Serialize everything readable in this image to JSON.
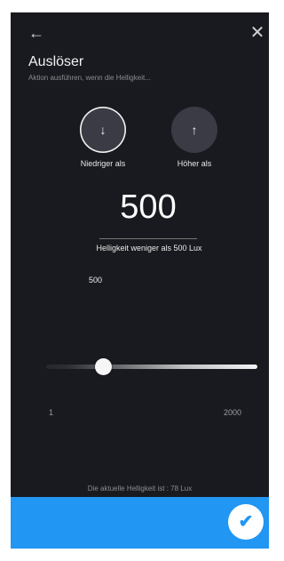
{
  "header": {
    "back_icon": "←",
    "close_icon": "✕",
    "title": "Auslöser",
    "subtitle": "Aktion ausführen, wenn die Helligkeit..."
  },
  "options": {
    "low_icon": "↓",
    "low_label": "Niedriger als",
    "high_icon": "↑",
    "high_label": "Höher als",
    "selected": "low"
  },
  "threshold": {
    "value": "500",
    "description": "Helligkeit weniger als 500 Lux",
    "slider_value": "500"
  },
  "slider": {
    "min": "1",
    "max": "2000",
    "value_fraction": 0.25
  },
  "status": {
    "current_text": "Die aktuelle Helligkeit ist : 78 Lux"
  },
  "footer": {
    "confirm_icon": "✔"
  },
  "colors": {
    "background": "#191a1f",
    "accent": "#2196f3",
    "button_bg": "#3a3b44"
  }
}
